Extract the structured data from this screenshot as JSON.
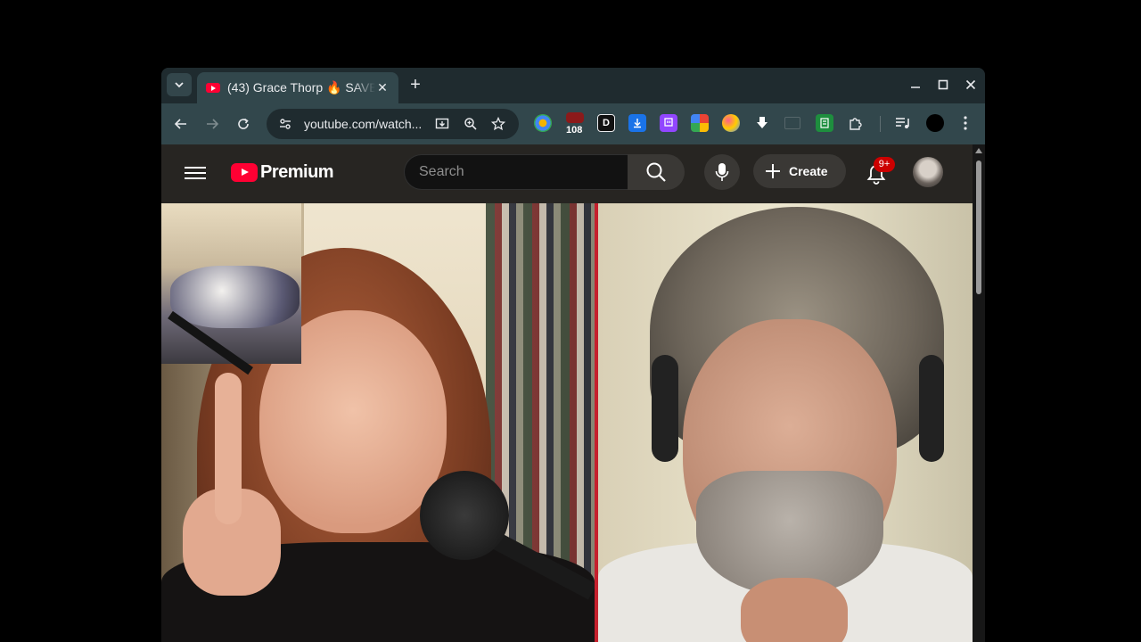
{
  "browser": {
    "tab": {
      "title": "(43) Grace Thorp 🔥 SAVE",
      "favicon": "youtube-favicon",
      "close_glyph": "✕"
    },
    "new_tab_glyph": "+",
    "window_controls": {
      "minimize": "–",
      "maximize": "□",
      "close": "✕"
    },
    "toolbar": {
      "url": "youtube.com/watch...",
      "extension_badge": "108"
    }
  },
  "youtube": {
    "logo_text": "Premium",
    "search": {
      "placeholder": "Search"
    },
    "create_label": "Create",
    "notification_badge": "9+"
  },
  "colors": {
    "youtube_red": "#ff0033",
    "browser_frame": "#32474c",
    "masthead": "#272522",
    "video_divider": "#c5202d"
  }
}
